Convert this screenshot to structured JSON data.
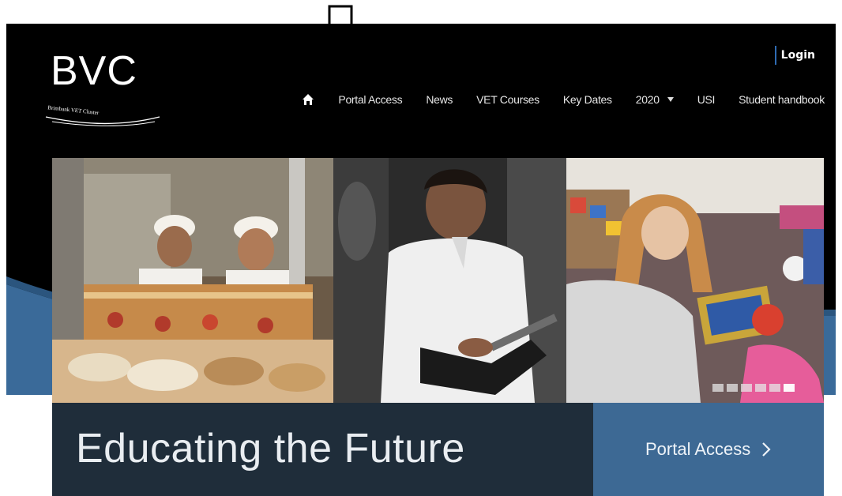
{
  "brand": {
    "logo_text": "BVC",
    "logo_subtext": "Brimbank VET Cluster"
  },
  "header": {
    "login_label": "Login"
  },
  "nav": {
    "home_icon": "home-icon",
    "items": [
      {
        "label": "Portal Access"
      },
      {
        "label": "News"
      },
      {
        "label": "VET Courses"
      },
      {
        "label": "Key Dates"
      },
      {
        "label": "2020",
        "dropdown": true
      },
      {
        "label": "USI"
      },
      {
        "label": "Student handbook"
      }
    ]
  },
  "hero": {
    "tagline": "Educating the Future",
    "cta_label": "Portal Access",
    "cta_icon": "chevron-right-icon",
    "slider_count": 6,
    "active_slide": 5
  },
  "colors": {
    "page_bg": "#000000",
    "accent_blue": "#3d6994",
    "wave_blue": "#3a6a99",
    "tagline_bg": "#1f2d3a",
    "login_border": "#2f6bb3"
  }
}
